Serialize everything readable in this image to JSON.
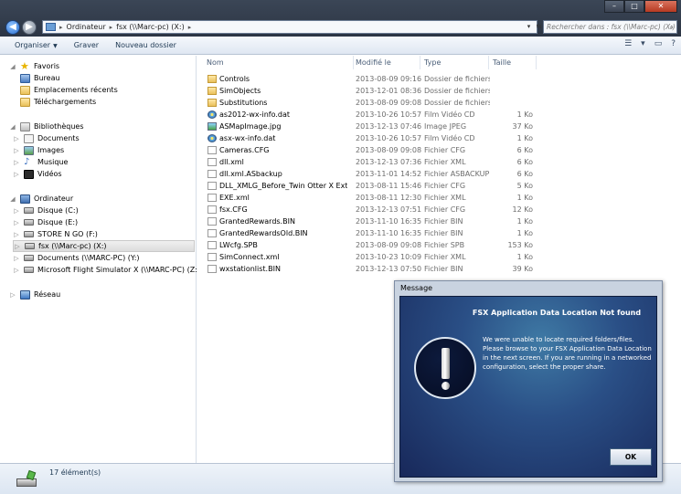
{
  "address": {
    "crumbs": [
      "Ordinateur",
      "fsx (\\\\Marc-pc) (X:)"
    ],
    "search_placeholder": "Rechercher dans : fsx (\\\\Marc-pc) (X:)"
  },
  "toolbar": {
    "organize": "Organiser",
    "burn": "Graver",
    "new_folder": "Nouveau dossier"
  },
  "nav": {
    "favorites": "Favoris",
    "desktop": "Bureau",
    "recent": "Emplacements récents",
    "downloads": "Téléchargements",
    "libraries": "Bibliothèques",
    "documents": "Documents",
    "images": "Images",
    "music": "Musique",
    "videos": "Vidéos",
    "computer": "Ordinateur",
    "drive_c": "Disque (C:)",
    "drive_e": "Disque (E:)",
    "drive_f": "STORE N GO (F:)",
    "drive_x": "fsx (\\\\Marc-pc) (X:)",
    "drive_y": "Documents (\\\\MARC-PC) (Y:)",
    "drive_z": "Microsoft Flight Simulator X (\\\\MARC-PC) (Z:)",
    "network": "Réseau"
  },
  "columns": {
    "name": "Nom",
    "modified": "Modifié le",
    "type": "Type",
    "size": "Taille"
  },
  "files": [
    {
      "name": "Controls",
      "date": "2013-08-09 09:16",
      "type": "Dossier de fichiers",
      "size": "",
      "icon": "folder"
    },
    {
      "name": "SimObjects",
      "date": "2013-12-01 08:36",
      "type": "Dossier de fichiers",
      "size": "",
      "icon": "folder"
    },
    {
      "name": "Substitutions",
      "date": "2013-08-09 09:08",
      "type": "Dossier de fichiers",
      "size": "",
      "icon": "folder"
    },
    {
      "name": "as2012-wx-info.dat",
      "date": "2013-10-26 10:57",
      "type": "Film Vidéo CD",
      "size": "1 Ko",
      "icon": "cd"
    },
    {
      "name": "ASMapImage.jpg",
      "date": "2013-12-13 07:46",
      "type": "Image JPEG",
      "size": "37 Ko",
      "icon": "jpg"
    },
    {
      "name": "asx-wx-info.dat",
      "date": "2013-10-26 10:57",
      "type": "Film Vidéo CD",
      "size": "1 Ko",
      "icon": "cd"
    },
    {
      "name": "Cameras.CFG",
      "date": "2013-08-09 09:08",
      "type": "Fichier CFG",
      "size": "6 Ko",
      "icon": "file"
    },
    {
      "name": "dll.xml",
      "date": "2013-12-13 07:36",
      "type": "Fichier XML",
      "size": "6 Ko",
      "icon": "file"
    },
    {
      "name": "dll.xml.ASbackup",
      "date": "2013-11-01 14:52",
      "type": "Fichier ASBACKUP",
      "size": "6 Ko",
      "icon": "file"
    },
    {
      "name": "DLL_XMLG_Before_Twin Otter X Extende...",
      "date": "2013-08-11 15:46",
      "type": "Fichier CFG",
      "size": "5 Ko",
      "icon": "file"
    },
    {
      "name": "EXE.xml",
      "date": "2013-08-11 12:30",
      "type": "Fichier XML",
      "size": "1 Ko",
      "icon": "file"
    },
    {
      "name": "fsx.CFG",
      "date": "2013-12-13 07:51",
      "type": "Fichier CFG",
      "size": "12 Ko",
      "icon": "file"
    },
    {
      "name": "GrantedRewards.BIN",
      "date": "2013-11-10 16:35",
      "type": "Fichier BIN",
      "size": "1 Ko",
      "icon": "file"
    },
    {
      "name": "GrantedRewardsOld.BIN",
      "date": "2013-11-10 16:35",
      "type": "Fichier BIN",
      "size": "1 Ko",
      "icon": "file"
    },
    {
      "name": "LWcfg.SPB",
      "date": "2013-08-09 09:08",
      "type": "Fichier SPB",
      "size": "153 Ko",
      "icon": "file"
    },
    {
      "name": "SimConnect.xml",
      "date": "2013-10-23 10:09",
      "type": "Fichier XML",
      "size": "1 Ko",
      "icon": "file"
    },
    {
      "name": "wxstationlist.BIN",
      "date": "2013-12-13 07:50",
      "type": "Fichier BIN",
      "size": "39 Ko",
      "icon": "file"
    }
  ],
  "status": {
    "count": "17 élément(s)"
  },
  "dialog": {
    "window_title": "Message",
    "heading": "FSX Application Data Location Not found",
    "line1": "We were unable to locate required folders/files.",
    "line2": "Please browse to your FSX Application Data Location",
    "line3": "in the next screen.  If you are running in a networked",
    "line4": "configuration, select the proper share.",
    "ok": "OK"
  }
}
